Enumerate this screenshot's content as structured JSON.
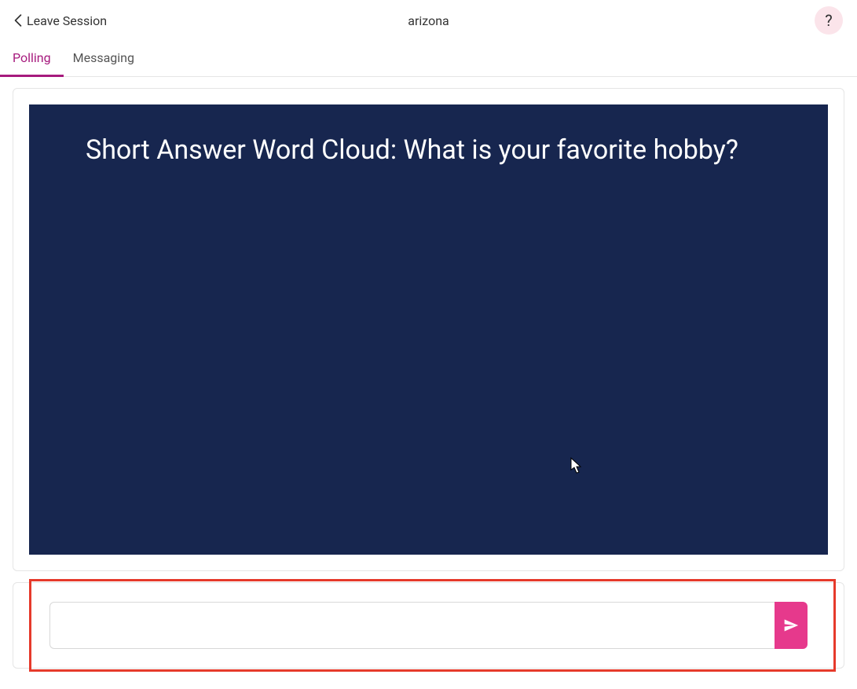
{
  "header": {
    "leave_label": "Leave Session",
    "session_title": "arizona",
    "help_label": "?"
  },
  "tabs": [
    {
      "label": "Polling",
      "active": true
    },
    {
      "label": "Messaging",
      "active": false
    }
  ],
  "question": {
    "text": "Short Answer Word Cloud: What is your favorite hobby?"
  },
  "answer": {
    "input_value": "",
    "placeholder": ""
  }
}
